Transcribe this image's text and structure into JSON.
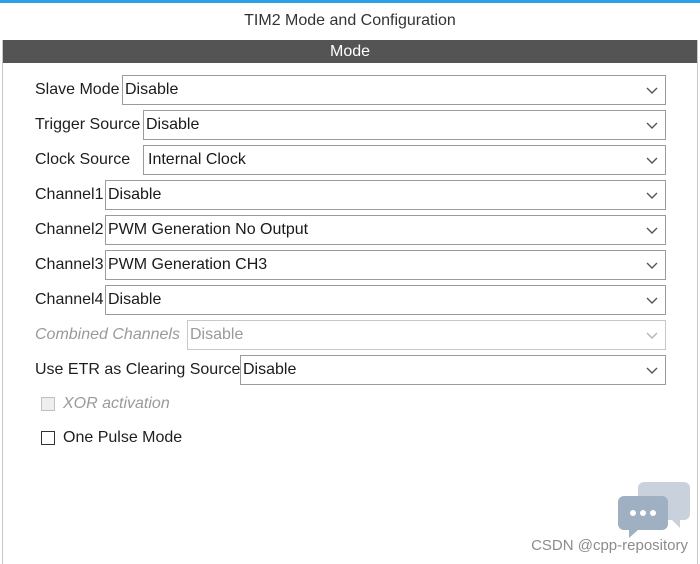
{
  "window": {
    "title": "TIM2 Mode and Configuration",
    "accent_color": "#29a3e3"
  },
  "section": {
    "title": "Mode"
  },
  "fields": [
    {
      "label": "Slave Mode",
      "value": "Disable",
      "enabled": true
    },
    {
      "label": "Trigger Source",
      "value": "Disable",
      "enabled": true
    },
    {
      "label": "Clock Source",
      "value": "Internal Clock",
      "enabled": true
    },
    {
      "label": "Channel1",
      "value": "Disable",
      "enabled": true
    },
    {
      "label": "Channel2",
      "value": "PWM Generation No Output",
      "enabled": true
    },
    {
      "label": "Channel3",
      "value": "PWM Generation CH3",
      "enabled": true
    },
    {
      "label": "Channel4",
      "value": "Disable",
      "enabled": true
    },
    {
      "label": "Combined Channels",
      "value": "Disable",
      "enabled": false
    },
    {
      "label": "Use ETR as Clearing Source",
      "value": "Disable",
      "enabled": true
    }
  ],
  "checkboxes": [
    {
      "label": "XOR activation",
      "checked": false,
      "enabled": false
    },
    {
      "label": "One Pulse Mode",
      "checked": false,
      "enabled": true
    }
  ],
  "watermark": {
    "text": "CSDN @cpp-repository"
  },
  "icons": {
    "dropdown": "chevron-down-icon",
    "chat": "chat-bubble-icon"
  }
}
